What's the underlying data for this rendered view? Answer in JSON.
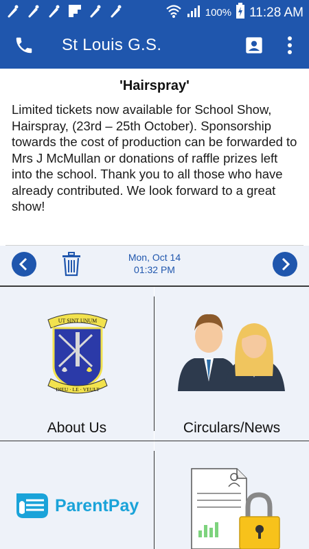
{
  "status_bar": {
    "battery": "100%",
    "time": "11:28 AM"
  },
  "app_bar": {
    "title": "St Louis G.S."
  },
  "notice": {
    "title": "'Hairspray'",
    "body": "Limited tickets now available for School Show, Hairspray, (23rd – 25th October). Sponsorship towards the cost of production can be forwarded to Mrs J McMullan or donations of raffle prizes left into the school. Thank you to all those who have already contributed. We look forward to a great show!",
    "date": "Mon, Oct 14",
    "time": "01:32 PM"
  },
  "tiles": [
    {
      "label": "About Us",
      "icon": "school-crest-icon",
      "crest_top": "UT SINT UNUM",
      "crest_bottom": "DIEU · LE · VEULT"
    },
    {
      "label": "Circulars/News",
      "icon": "students-icon"
    },
    {
      "label": "",
      "icon": "parentpay-logo",
      "logo_text": "ParentPay"
    },
    {
      "label": "",
      "icon": "secure-document-icon"
    }
  ],
  "colors": {
    "brand_blue": "#1f56ad",
    "tile_bg": "#eef2f9",
    "parentpay_blue": "#1aa3d9"
  }
}
